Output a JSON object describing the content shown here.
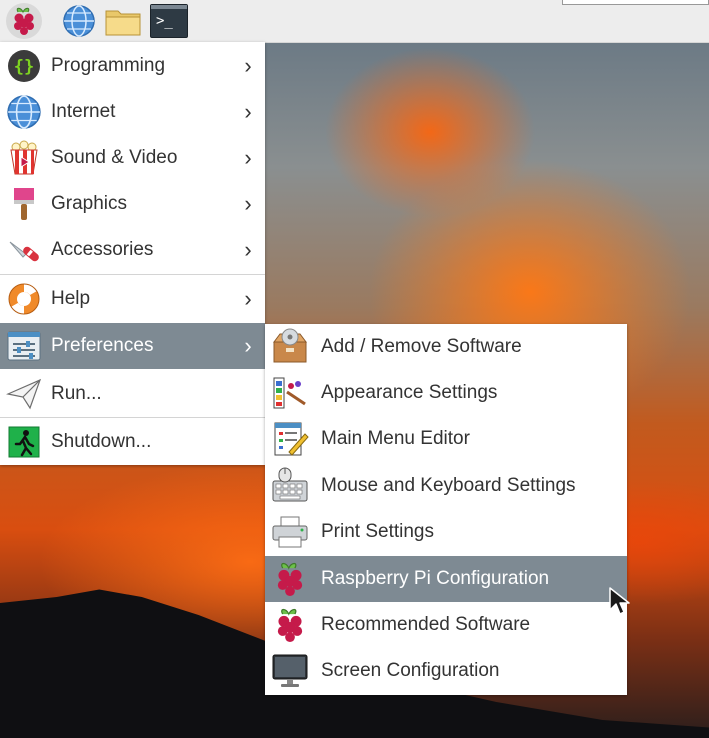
{
  "panel": {
    "launchers": [
      {
        "name": "web-browser",
        "icon": "globe-icon"
      },
      {
        "name": "file-manager",
        "icon": "folder-icon"
      },
      {
        "name": "terminal",
        "icon": "terminal-icon"
      }
    ],
    "terminal_glyph": ">_"
  },
  "main_menu": {
    "items": [
      {
        "label": "Programming",
        "icon": "programming-icon",
        "arrow": "›"
      },
      {
        "label": "Internet",
        "icon": "globe-icon",
        "arrow": "›"
      },
      {
        "label": "Sound & Video",
        "icon": "popcorn-icon",
        "arrow": "›"
      },
      {
        "label": "Graphics",
        "icon": "paintbrush-icon",
        "arrow": "›"
      },
      {
        "label": "Accessories",
        "icon": "pocket-knife-icon",
        "arrow": "›"
      },
      {
        "label": "Help",
        "icon": "lifebuoy-icon",
        "arrow": "›"
      },
      {
        "label": "Preferences",
        "icon": "preferences-icon",
        "arrow": "›",
        "active": true
      },
      {
        "label": "Run...",
        "icon": "paper-plane-icon"
      },
      {
        "label": "Shutdown...",
        "icon": "exit-icon"
      }
    ]
  },
  "preferences_submenu": {
    "items": [
      {
        "label": "Add / Remove Software",
        "icon": "package-icon"
      },
      {
        "label": "Appearance Settings",
        "icon": "palette-icon"
      },
      {
        "label": "Main Menu Editor",
        "icon": "menu-editor-icon"
      },
      {
        "label": "Mouse and Keyboard Settings",
        "icon": "keyboard-mouse-icon"
      },
      {
        "label": "Print Settings",
        "icon": "printer-icon"
      },
      {
        "label": "Raspberry Pi Configuration",
        "icon": "raspberry-icon",
        "active": true
      },
      {
        "label": "Recommended Software",
        "icon": "raspberry-icon"
      },
      {
        "label": "Screen Configuration",
        "icon": "monitor-icon"
      }
    ]
  },
  "colors": {
    "highlight": "#7e8a93",
    "menu_bg": "#ffffff",
    "panel_bg": "#ededed",
    "raspberry_red": "#c51a4a",
    "raspberry_leaf": "#6cc04a"
  }
}
